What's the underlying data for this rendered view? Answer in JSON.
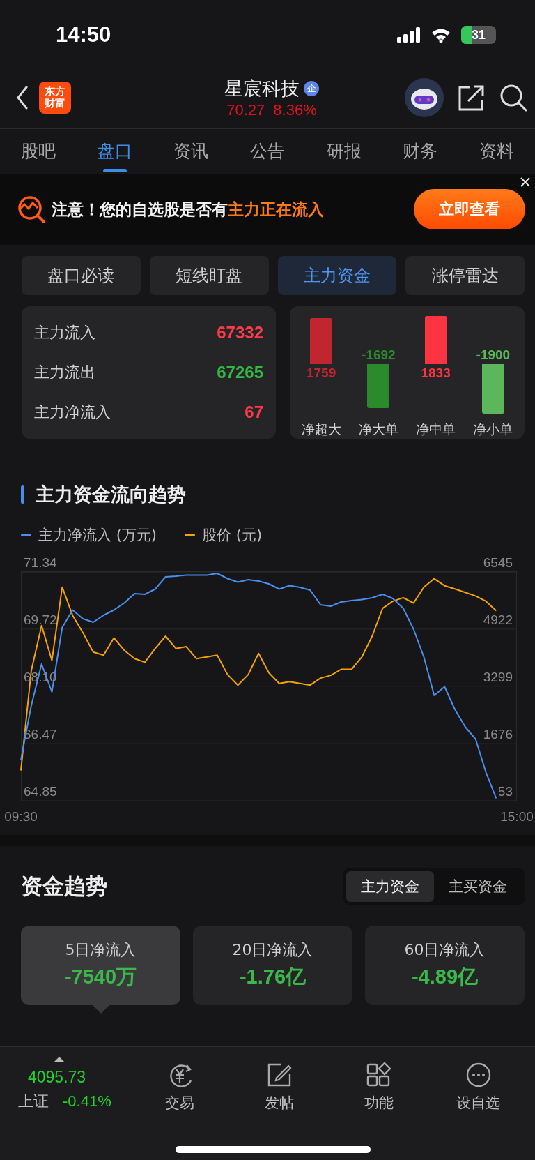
{
  "status_bar": {
    "time": "14:50",
    "battery": "31"
  },
  "header": {
    "logo": [
      "东方",
      "财富"
    ],
    "name": "星宸科技",
    "badge": "企",
    "price": "70.27",
    "change": "8.36%"
  },
  "tabs": [
    {
      "label": "股吧",
      "selected": false
    },
    {
      "label": "盘口",
      "selected": true
    },
    {
      "label": "资讯",
      "selected": false
    },
    {
      "label": "公告",
      "selected": false
    },
    {
      "label": "研报",
      "selected": false
    },
    {
      "label": "财务",
      "selected": false
    },
    {
      "label": "资料",
      "selected": false
    }
  ],
  "banner": {
    "text": "注意！您的自选股是否有",
    "highlight": "主力正在流入",
    "button": "立即查看"
  },
  "sub_tabs": [
    {
      "label": "盘口必读",
      "selected": false
    },
    {
      "label": "短线盯盘",
      "selected": false
    },
    {
      "label": "主力资金",
      "selected": true
    },
    {
      "label": "涨停雷达",
      "selected": false
    }
  ],
  "flow_summary": [
    {
      "label": "主力流入",
      "value": "67332",
      "color": "#ff3b4a"
    },
    {
      "label": "主力流出",
      "value": "67265",
      "color": "#33b843"
    },
    {
      "label": "主力净流入",
      "value": "67",
      "color": "#ff3b4a"
    }
  ],
  "net_flows": [
    {
      "label": "净超大",
      "value": "1759",
      "kind": "inflow",
      "color": "#c0262f"
    },
    {
      "label": "净大单",
      "value": "-1692",
      "kind": "outflow",
      "color": "#2a8a2c"
    },
    {
      "label": "净中单",
      "value": "1833",
      "kind": "inflow",
      "color": "#fe3341"
    },
    {
      "label": "净小单",
      "value": "-1900",
      "kind": "outflow",
      "color": "#5cb65c"
    }
  ],
  "trend_chart": {
    "title": "主力资金流向趋势",
    "layers": [
      {
        "chart_data": {
          "type": "line",
          "grid": true,
          "categories": [
            "09:30",
            null,
            null,
            null,
            null,
            null,
            null,
            null,
            null,
            null,
            null,
            null,
            null,
            null,
            null,
            null,
            null,
            null,
            null,
            null,
            null,
            null,
            null,
            null,
            null,
            null,
            null,
            null,
            null,
            null,
            null,
            null,
            null,
            null,
            null,
            null,
            null,
            null,
            null,
            null,
            null,
            null,
            null,
            null,
            null,
            null,
            null,
            null,
            "15:00"
          ],
          "ylim": [
            64.85,
            71.34
          ],
          "yticks": [
            {
              "value": 71.34,
              "label": "71.34"
            },
            {
              "value": 69.72,
              "label": "69.72"
            },
            {
              "value": 68.1,
              "label": "68.10"
            },
            {
              "value": 66.47,
              "label": "66.47"
            },
            {
              "value": 64.85,
              "label": "64.85"
            }
          ],
          "series": [
            {
              "name": "股价 (元)",
              "color": "#f5a300",
              "values": [
                65.71,
                68.53,
                69.82,
                68.83,
                70.91,
                70.11,
                69.62,
                69.07,
                68.98,
                69.47,
                69.12,
                68.88,
                68.78,
                69.17,
                69.52,
                69.17,
                69.22,
                68.88,
                68.93,
                68.98,
                68.43,
                68.13,
                68.43,
                69.03,
                68.48,
                68.18,
                68.23,
                68.18,
                68.13,
                68.33,
                68.41,
                68.58,
                68.58,
                68.93,
                69.52,
                70.31,
                70.51,
                70.61,
                70.46,
                70.91,
                71.15,
                70.95,
                70.86,
                70.76,
                70.66,
                70.51,
                70.24,
                null,
                null
              ]
            }
          ]
        }
      },
      {
        "chart_data": {
          "type": "line",
          "categories": [
            null,
            null,
            null,
            null,
            null,
            null,
            null,
            null,
            null,
            null,
            null,
            null,
            null,
            null,
            null,
            null,
            null,
            null,
            null,
            null,
            null,
            null,
            null,
            null,
            null,
            null,
            null,
            null,
            null,
            null,
            null,
            null,
            null,
            null,
            null,
            null,
            null,
            null,
            null,
            null,
            null,
            null,
            null,
            null,
            null,
            null,
            null
          ],
          "ylim": [
            53,
            6545
          ],
          "yticks": [
            {
              "value": 6545,
              "label": "6545"
            },
            {
              "value": 4922,
              "label": "4922"
            },
            {
              "value": 3299,
              "label": "3299"
            },
            {
              "value": 1676,
              "label": "1676"
            },
            {
              "value": 53,
              "label": "53"
            }
          ],
          "series": [
            {
              "name": "主力净流入 (万元)",
              "color": "#4a8ff0",
              "values": [
                1211,
                2745,
                3932,
                3141,
                4971,
                5466,
                5219,
                5120,
                5318,
                5466,
                5664,
                5931,
                5911,
                6060,
                6406,
                6426,
                6456,
                6456,
                6456,
                6505,
                6357,
                6258,
                6327,
                6287,
                6208,
                6060,
                6159,
                6109,
                6030,
                5615,
                5575,
                5694,
                5733,
                5763,
                5812,
                5911,
                5793,
                5516,
                4922,
                4130,
                3042,
                3289,
                2646,
                2151,
                1805,
                864,
                122
              ]
            }
          ]
        }
      }
    ]
  },
  "fund_trend": {
    "title": "资金趋势",
    "toggle": [
      {
        "label": "主力资金",
        "selected": true
      },
      {
        "label": "主买资金",
        "selected": false
      }
    ],
    "periods": [
      {
        "label": "5日净流入",
        "value": "-7540万",
        "selected": true
      },
      {
        "label": "20日净流入",
        "value": "-1.76亿",
        "selected": false
      },
      {
        "label": "60日净流入",
        "value": "-4.89亿",
        "selected": false
      }
    ]
  },
  "bottom_nav": {
    "index": {
      "value": "4095.73",
      "name": "上证",
      "change": "-0.41%"
    },
    "items": [
      {
        "label": "交易"
      },
      {
        "label": "发帖"
      },
      {
        "label": "功能"
      },
      {
        "label": "设自选"
      }
    ]
  }
}
